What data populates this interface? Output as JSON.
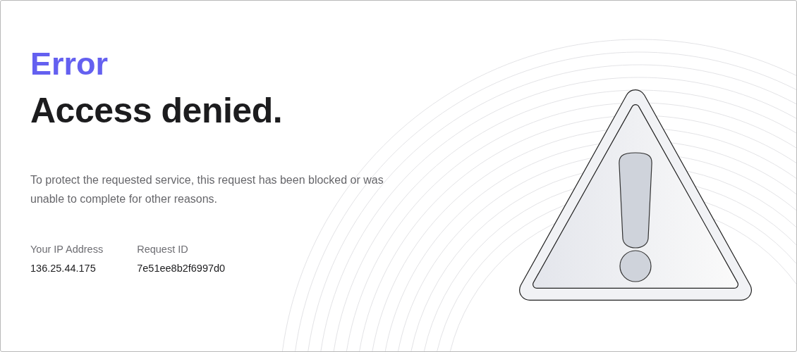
{
  "eyebrow": "Error",
  "title": "Access denied.",
  "message": "To protect the requested service, this request has been blocked or was unable to complete for other reasons.",
  "details": [
    {
      "label": "Your IP Address",
      "value": "136.25.44.175"
    },
    {
      "label": "Request ID",
      "value": "7e51ee8b2f6997d0"
    }
  ]
}
